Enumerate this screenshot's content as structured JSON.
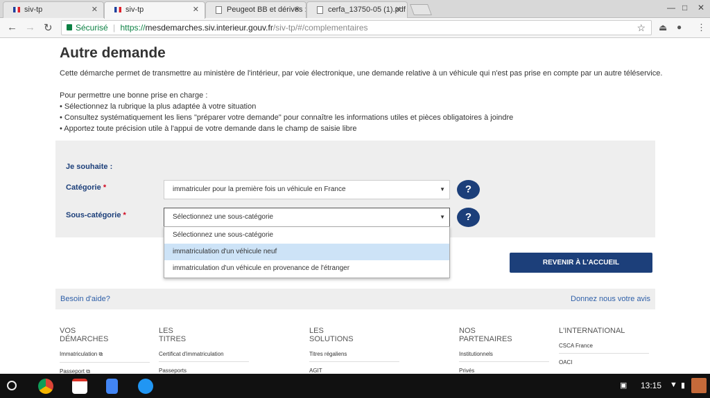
{
  "browser": {
    "tabs": [
      {
        "title": "siv-tp"
      },
      {
        "title": "siv-tp"
      },
      {
        "title": "Peugeot BB et dérivés :"
      },
      {
        "title": "cerfa_13750-05 (1).pdf"
      }
    ],
    "secure_label": "Sécurisé",
    "url_scheme": "https://",
    "url_host": "mesdemarches.siv.interieur.gouv.fr",
    "url_path": "/siv-tp/#/complementaires"
  },
  "page": {
    "title": "Autre demande",
    "intro": "Cette démarche permet de transmettre au ministère de l'intérieur, par voie électronique, une demande relative à un véhicule qui n'est pas prise en compte par un autre téléservice.",
    "help_heading": "Pour permettre une bonne prise en charge :",
    "help_items": [
      "• Sélectionnez la rubrique la plus adaptée à votre situation",
      "• Consultez systématiquement les liens \"préparer votre demande\" pour connaître les informations utiles et pièces obligatoires à joindre",
      "• Apportez toute précision utile à l'appui de votre demande dans le champ de saisie libre"
    ],
    "form": {
      "wish_label": "Je souhaite :",
      "category_label": "Catégorie",
      "category_value": "immatriculer pour la première fois un véhicule en France",
      "subcategory_label": "Sous-catégorie",
      "subcategory_value": "Sélectionnez une sous-catégorie",
      "required_mark": "*",
      "help_button": "?",
      "subcategory_options": [
        "Sélectionnez une sous-catégorie",
        "immatriculation d'un véhicule neuf",
        "immatriculation d'un véhicule en provenance de l'étranger"
      ]
    },
    "back_button": "REVENIR À L'ACCUEIL",
    "help_bar": {
      "left": "Besoin d'aide?",
      "right": "Donnez nous votre avis"
    },
    "footer": [
      {
        "title_line1": "VOS",
        "title_line2": "DÉMARCHES",
        "links": [
          "Immatriculation ⧉",
          "Passeport ⧉"
        ]
      },
      {
        "title_line1": "LES",
        "title_line2": "TITRES",
        "links": [
          "Certificat d'immatriculation",
          "Passeports"
        ]
      },
      {
        "title_line1": "LES",
        "title_line2": "SOLUTIONS",
        "links": [
          "Titres régaliens",
          "AGIT"
        ]
      },
      {
        "title_line1": "NOS",
        "title_line2": "PARTENAIRES",
        "links": [
          "Institutionnels",
          "Privés"
        ]
      },
      {
        "title_line1": "L'INTERNATIONAL",
        "title_line2": "",
        "links": [
          "CSCA France",
          "OACI"
        ]
      }
    ]
  },
  "system": {
    "time": "13:15"
  }
}
